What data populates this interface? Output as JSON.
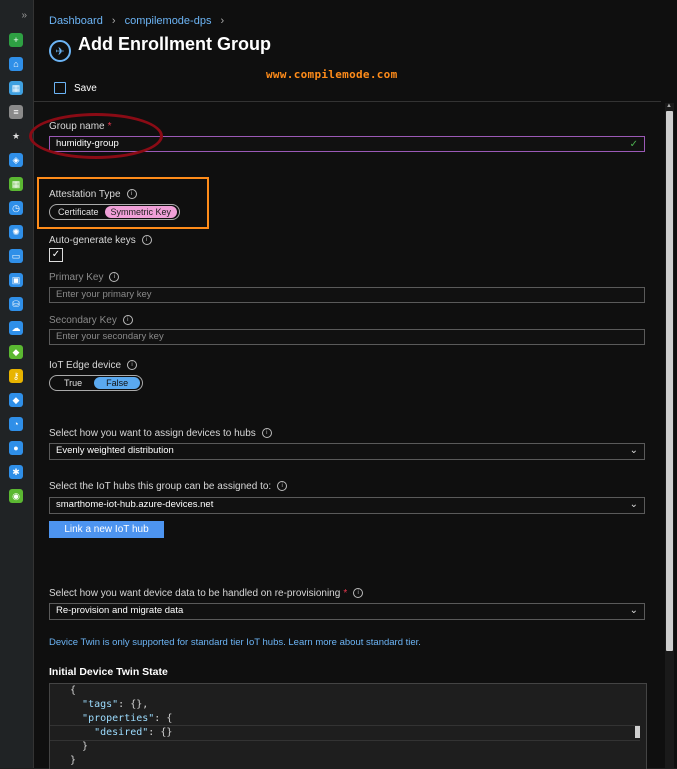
{
  "sidebar": {
    "collapse_icon": "double-chevron-right-icon",
    "icons": [
      {
        "name": "plus-icon",
        "color": "#2ea043",
        "glyph": "+"
      },
      {
        "name": "home-icon",
        "color": "#2f8fe8",
        "glyph": "⌂"
      },
      {
        "name": "dashboard-icon",
        "color": "#3fa0e0",
        "glyph": "▦"
      },
      {
        "name": "list-icon",
        "color": "#8a8a8a",
        "glyph": "≡"
      },
      {
        "name": "star-icon",
        "color": "#202325",
        "glyph": "★"
      },
      {
        "name": "resource-group-icon",
        "color": "#2f8fe8",
        "glyph": "◈"
      },
      {
        "name": "all-resources-icon",
        "color": "#5bb832",
        "glyph": "▦"
      },
      {
        "name": "clock-icon",
        "color": "#2f8fe8",
        "glyph": "◷"
      },
      {
        "name": "globe-icon",
        "color": "#2f8fe8",
        "glyph": "✺"
      },
      {
        "name": "monitor-icon",
        "color": "#2f8fe8",
        "glyph": "▭"
      },
      {
        "name": "virtual-machine-icon",
        "color": "#2f8fe8",
        "glyph": "▣"
      },
      {
        "name": "database-icon",
        "color": "#2f8fe8",
        "glyph": "⛁"
      },
      {
        "name": "cloud-icon",
        "color": "#2f8fe8",
        "glyph": "☁"
      },
      {
        "name": "shield-icon",
        "color": "#5bb832",
        "glyph": "◆"
      },
      {
        "name": "key-icon",
        "color": "#e8b400",
        "glyph": "⚷"
      },
      {
        "name": "diamond-icon",
        "color": "#2f8fe8",
        "glyph": "◆"
      },
      {
        "name": "gauge-icon",
        "color": "#2f8fe8",
        "glyph": "◔"
      },
      {
        "name": "user-icon",
        "color": "#2f8fe8",
        "glyph": "●"
      },
      {
        "name": "network-icon",
        "color": "#2f8fe8",
        "glyph": "✱"
      },
      {
        "name": "circle-icon",
        "color": "#5bb832",
        "glyph": "◉"
      }
    ]
  },
  "breadcrumb": {
    "items": [
      "Dashboard",
      "compilemode-dps"
    ]
  },
  "page": {
    "title": "Add Enrollment Group",
    "title_icon": "dps-icon"
  },
  "watermark": "www.compilemode.com",
  "toolbar": {
    "save_label": "Save"
  },
  "form": {
    "group_name": {
      "label": "Group name",
      "required": "*",
      "value": "humidity-group"
    },
    "attestation": {
      "label": "Attestation Type",
      "options": [
        "Certificate",
        "Symmetric Key"
      ],
      "selected": "Symmetric Key"
    },
    "auto_keys": {
      "label": "Auto-generate keys",
      "checked": true
    },
    "primary_key": {
      "label": "Primary Key",
      "placeholder": "Enter your primary key"
    },
    "secondary_key": {
      "label": "Secondary Key",
      "placeholder": "Enter your secondary key"
    },
    "edge": {
      "label": "IoT Edge device",
      "options": [
        "True",
        "False"
      ],
      "selected": "False"
    },
    "assign": {
      "label": "Select how you want to assign devices to hubs",
      "value": "Evenly weighted distribution"
    },
    "hubs": {
      "label": "Select the IoT hubs this group can be assigned to:",
      "value": "smarthome-iot-hub.azure-devices.net"
    },
    "link_hub_label": "Link a new IoT hub",
    "reprovision": {
      "label": "Select how you want device data to be handled on re-provisioning",
      "required": "*",
      "value": "Re-provision and migrate data"
    },
    "twin_note": "Device Twin is only supported for standard tier IoT hubs. Learn more about standard tier.",
    "twin_title": "Initial Device Twin State"
  },
  "twin_json": {
    "open_brace": "{",
    "tags_key": "\"tags\"",
    "tags_value": ": {},",
    "properties_key": "\"properties\"",
    "properties_value": ": {",
    "desired_key": "\"desired\"",
    "desired_value": ": {}",
    "close_inner": "}",
    "close_outer": "}"
  }
}
